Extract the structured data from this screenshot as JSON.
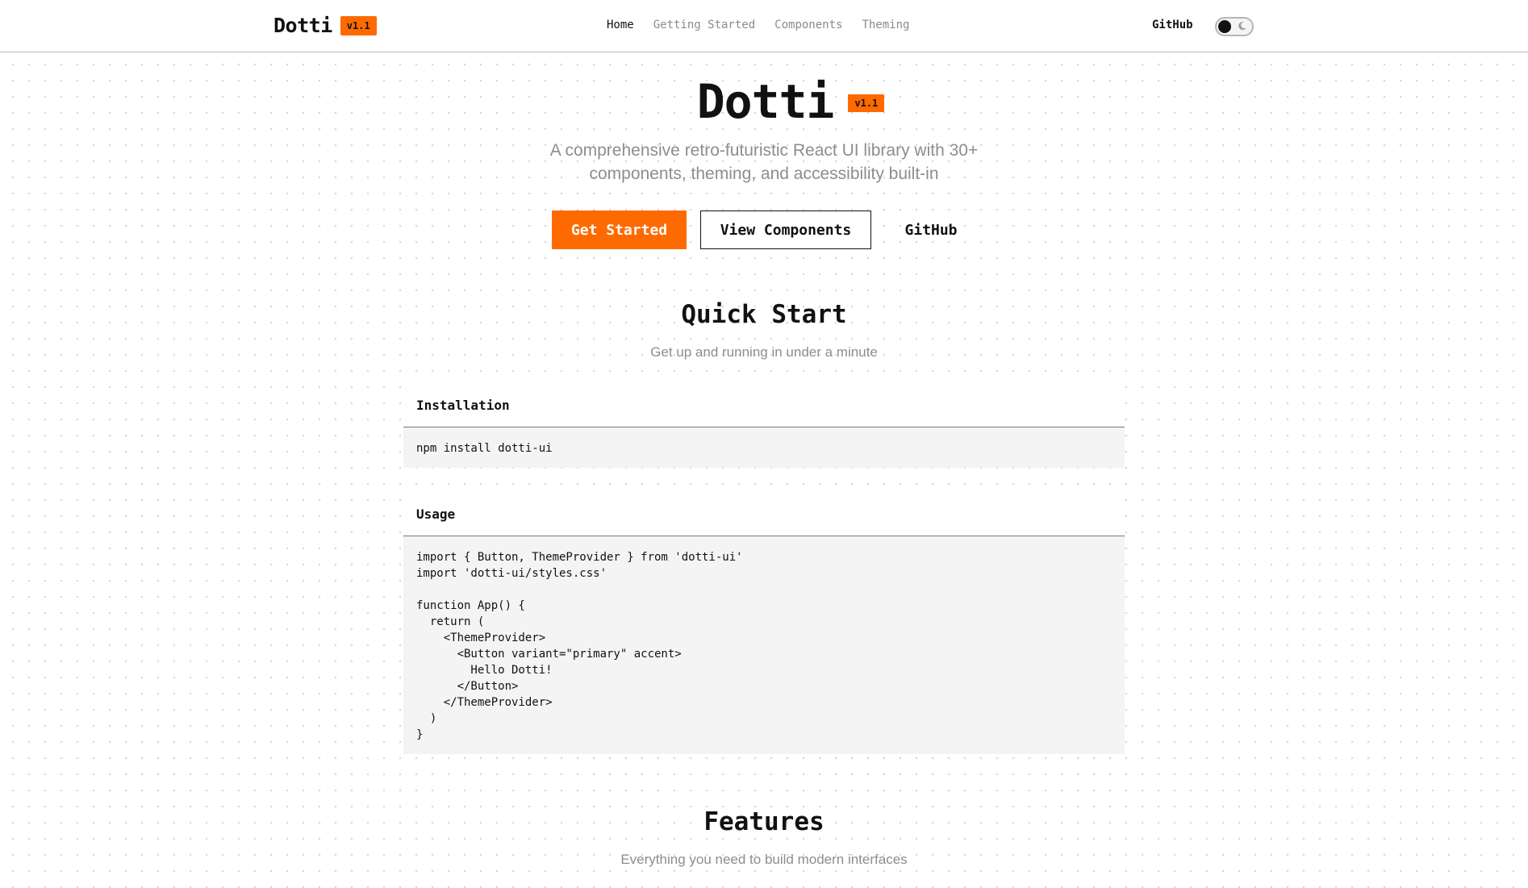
{
  "colors": {
    "accent": "#ff6a00",
    "text": "#111111",
    "muted": "#8d8d8d",
    "code_bg": "#f4f4f4"
  },
  "header": {
    "brand": "Dotti",
    "version": "v1.1",
    "nav": [
      "Home",
      "Getting Started",
      "Components",
      "Theming"
    ],
    "active_nav": "Home",
    "github_label": "GitHub",
    "theme_toggle_icon": "moon-icon"
  },
  "hero": {
    "title": "Dotti",
    "version": "v1.1",
    "subtitle": "A comprehensive retro-futuristic React UI library with 30+ components, theming, and accessibility built-in",
    "buttons": {
      "primary": "Get Started",
      "secondary": "View Components",
      "tertiary": "GitHub"
    }
  },
  "quick_start": {
    "title": "Quick Start",
    "subtitle": "Get up and running in under a minute",
    "installation": {
      "title": "Installation",
      "code": "npm install dotti-ui"
    },
    "usage": {
      "title": "Usage",
      "code": "import { Button, ThemeProvider } from 'dotti-ui'\nimport 'dotti-ui/styles.css'\n\nfunction App() {\n  return (\n    <ThemeProvider>\n      <Button variant=\"primary\" accent>\n        Hello Dotti!\n      </Button>\n    </ThemeProvider>\n  )\n}"
    }
  },
  "features": {
    "title": "Features",
    "subtitle": "Everything you need to build modern interfaces"
  }
}
